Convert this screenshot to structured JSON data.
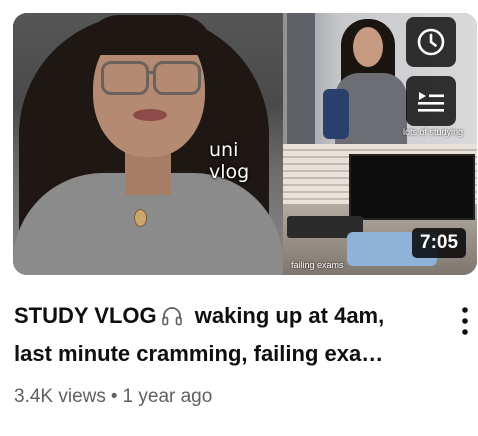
{
  "video": {
    "title_part1": "STUDY VLOG",
    "title_part2": " waking up at 4am,",
    "title_line2": "last minute cramming, failing exa",
    "title_ellipsis": "…",
    "title_icon": "headphones-icon",
    "duration": "7:05",
    "views": "3.4K views",
    "separator": "•",
    "age": "1 year ago"
  },
  "thumbnail": {
    "caption_main": "uni vlog",
    "caption_top_right": "lots of studying",
    "caption_bottom_right": "failing exams"
  },
  "overlay_buttons": {
    "watch_later_icon": "clock-icon",
    "add_to_queue_icon": "add-to-queue-icon"
  },
  "menu": {
    "icon": "more-vertical-icon"
  },
  "colors": {
    "title": "#0f0f0f",
    "meta": "#606060",
    "overlay_bg": "#000000"
  }
}
